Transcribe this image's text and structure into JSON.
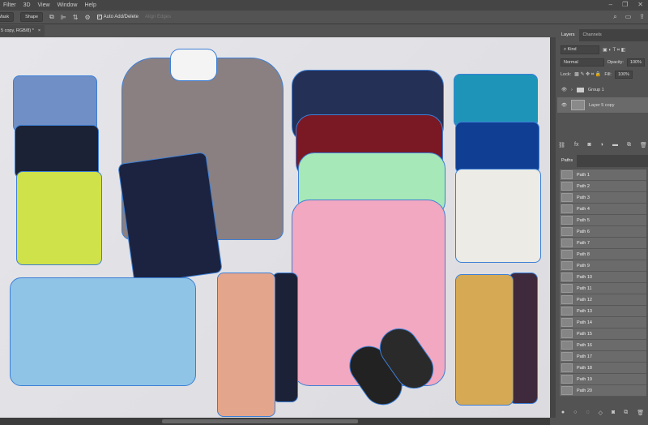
{
  "menu": [
    "Filter",
    "3D",
    "View",
    "Window",
    "Help"
  ],
  "window_controls": {
    "minimize": "–",
    "restore": "❐",
    "close": "✕"
  },
  "options": {
    "mask_label": "Mask",
    "shape_label": "Shape",
    "auto_add_delete": "Auto Add/Delete",
    "align_edges": "Align Edges"
  },
  "document_tab": {
    "title": "5 copy, RGB/8) *",
    "close": "×"
  },
  "layers_panel": {
    "tabs": [
      "Layers",
      "Channels"
    ],
    "filter_kind": "Kind",
    "blend_mode": "Normal",
    "opacity_label": "Opacity:",
    "opacity": "100%",
    "lock_label": "Lock:",
    "fill_label": "Fill:",
    "fill": "100%",
    "layers": [
      {
        "name": "Group 1",
        "type": "group"
      },
      {
        "name": "Layer 5 copy",
        "type": "layer",
        "selected": true
      }
    ]
  },
  "paths_panel": {
    "tab": "Paths",
    "paths": [
      "Path 1",
      "Path 2",
      "Path 3",
      "Path 4",
      "Path 5",
      "Path 6",
      "Path 7",
      "Path 8",
      "Path 9",
      "Path 10",
      "Path 11",
      "Path 12",
      "Path 13",
      "Path 14",
      "Path 15",
      "Path 16",
      "Path 17",
      "Path 18",
      "Path 19",
      "Path 20"
    ]
  },
  "colors": {
    "path_outline": "#3d7fd6",
    "ui_bg": "#535353"
  }
}
